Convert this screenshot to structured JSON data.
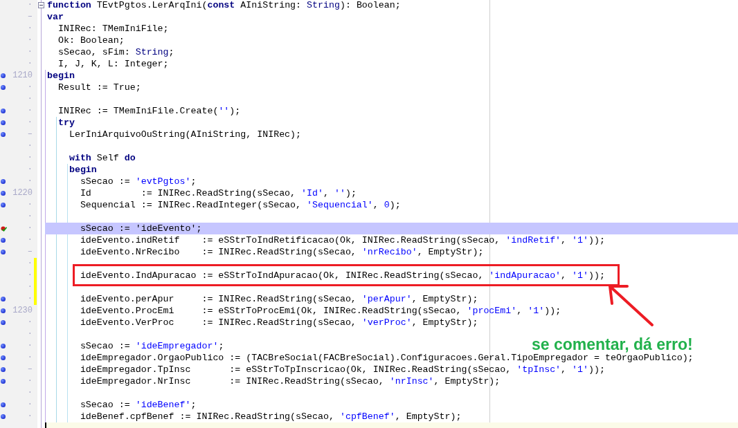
{
  "editor": {
    "lines": [
      {
        "gutter": "·",
        "breakpoint": false,
        "modified": false,
        "expanded": true,
        "highlighted": false,
        "tokens": [
          {
            "kind": "keyword",
            "text": "function"
          },
          {
            "kind": "plain",
            "text": " TEvtPgtos.LerArqIni("
          },
          {
            "kind": "keyword",
            "text": "const"
          },
          {
            "kind": "plain",
            "text": " AIniString: "
          },
          {
            "kind": "type",
            "text": "String"
          },
          {
            "kind": "plain",
            "text": "): Boolean;"
          }
        ]
      },
      {
        "gutter": "–",
        "breakpoint": false,
        "modified": false,
        "highlighted": false,
        "tokens": [
          {
            "kind": "keyword",
            "text": "var"
          }
        ]
      },
      {
        "gutter": "·",
        "breakpoint": false,
        "modified": false,
        "highlighted": false,
        "tokens": [
          {
            "kind": "plain",
            "text": "  INIRec: TMemIniFile;"
          }
        ]
      },
      {
        "gutter": "·",
        "breakpoint": false,
        "modified": false,
        "highlighted": false,
        "tokens": [
          {
            "kind": "plain",
            "text": "  Ok: Boolean;"
          }
        ]
      },
      {
        "gutter": "·",
        "breakpoint": false,
        "modified": false,
        "highlighted": false,
        "tokens": [
          {
            "kind": "plain",
            "text": "  sSecao, sFim: "
          },
          {
            "kind": "type",
            "text": "String"
          },
          {
            "kind": "plain",
            "text": ";"
          }
        ]
      },
      {
        "gutter": "·",
        "breakpoint": false,
        "modified": false,
        "highlighted": false,
        "tokens": [
          {
            "kind": "plain",
            "text": "  I, J, K, L: Integer;"
          }
        ]
      },
      {
        "gutter": "1210",
        "breakpoint": true,
        "modified": false,
        "highlighted": false,
        "tokens": [
          {
            "kind": "keyword",
            "text": "begin"
          }
        ]
      },
      {
        "gutter": "·",
        "breakpoint": true,
        "modified": false,
        "highlighted": false,
        "tokens": [
          {
            "kind": "plain",
            "text": "  Result := True;"
          }
        ]
      },
      {
        "gutter": "·",
        "breakpoint": false,
        "modified": false,
        "highlighted": false
      },
      {
        "gutter": "·",
        "breakpoint": true,
        "modified": false,
        "highlighted": false,
        "tokens": [
          {
            "kind": "plain",
            "text": "  INIRec := TMemIniFile.Create("
          },
          {
            "kind": "string",
            "text": "''"
          },
          {
            "kind": "plain",
            "text": ");"
          }
        ]
      },
      {
        "gutter": "·",
        "breakpoint": true,
        "modified": false,
        "highlighted": false,
        "tokens": [
          {
            "kind": "keyword",
            "text": "  try"
          }
        ]
      },
      {
        "gutter": "–",
        "breakpoint": true,
        "modified": false,
        "highlighted": false,
        "tokens": [
          {
            "kind": "plain",
            "text": "    LerIniArquivoOuString(AIniString, INIRec);"
          }
        ]
      },
      {
        "gutter": "·",
        "breakpoint": false,
        "modified": false,
        "highlighted": false
      },
      {
        "gutter": "·",
        "breakpoint": false,
        "modified": false,
        "highlighted": false,
        "tokens": [
          {
            "kind": "keyword",
            "text": "    with"
          },
          {
            "kind": "plain",
            "text": " Self "
          },
          {
            "kind": "keyword",
            "text": "do"
          }
        ]
      },
      {
        "gutter": "·",
        "breakpoint": false,
        "modified": false,
        "highlighted": false,
        "tokens": [
          {
            "kind": "keyword",
            "text": "    begin"
          }
        ]
      },
      {
        "gutter": "·",
        "breakpoint": true,
        "modified": false,
        "highlighted": false,
        "tokens": [
          {
            "kind": "plain",
            "text": "      sSecao := "
          },
          {
            "kind": "string",
            "text": "'evtPgtos'"
          },
          {
            "kind": "plain",
            "text": ";"
          }
        ]
      },
      {
        "gutter": "1220",
        "breakpoint": true,
        "modified": false,
        "highlighted": false,
        "tokens": [
          {
            "kind": "plain",
            "text": "      Id         := INIRec.ReadString(sSecao, "
          },
          {
            "kind": "string",
            "text": "'Id'"
          },
          {
            "kind": "plain",
            "text": ", "
          },
          {
            "kind": "string",
            "text": "''"
          },
          {
            "kind": "plain",
            "text": ");"
          }
        ]
      },
      {
        "gutter": "·",
        "breakpoint": true,
        "modified": false,
        "highlighted": false,
        "tokens": [
          {
            "kind": "plain",
            "text": "      Sequencial := INIRec.ReadInteger(sSecao, "
          },
          {
            "kind": "string",
            "text": "'Sequencial'"
          },
          {
            "kind": "plain",
            "text": ", "
          },
          {
            "kind": "number",
            "text": "0"
          },
          {
            "kind": "plain",
            "text": ");"
          }
        ]
      },
      {
        "gutter": "·",
        "breakpoint": false,
        "modified": false,
        "highlighted": false
      },
      {
        "gutter": "·",
        "breakpoint": true,
        "verified": true,
        "modified": false,
        "highlighted": true,
        "tokens": [
          {
            "kind": "plain",
            "text": "      sSecao := 'ideEvento';"
          }
        ]
      },
      {
        "gutter": "·",
        "breakpoint": true,
        "modified": false,
        "highlighted": false,
        "tokens": [
          {
            "kind": "plain",
            "text": "      ideEvento.indRetif    := eSStrToIndRetificacao(Ok, INIRec.ReadString(sSecao, "
          },
          {
            "kind": "string",
            "text": "'indRetif'"
          },
          {
            "kind": "plain",
            "text": ", "
          },
          {
            "kind": "string",
            "text": "'1'"
          },
          {
            "kind": "plain",
            "text": "));"
          }
        ]
      },
      {
        "gutter": "–",
        "breakpoint": true,
        "modified": false,
        "highlighted": false,
        "tokens": [
          {
            "kind": "plain",
            "text": "      ideEvento.NrRecibo    := INIRec.ReadString(sSecao, "
          },
          {
            "kind": "string",
            "text": "'nrRecibo'"
          },
          {
            "kind": "plain",
            "text": ", EmptyStr);"
          }
        ]
      },
      {
        "gutter": "·",
        "breakpoint": false,
        "modified": true,
        "highlighted": false
      },
      {
        "gutter": "·",
        "breakpoint": false,
        "modified": true,
        "highlighted": false,
        "tokens": [
          {
            "kind": "plain",
            "text": "      ideEvento.IndApuracao := eSStrToIndApuracao(Ok, INIRec.ReadString(sSecao, "
          },
          {
            "kind": "string",
            "text": "'indApuracao'"
          },
          {
            "kind": "plain",
            "text": ", "
          },
          {
            "kind": "string",
            "text": "'1'"
          },
          {
            "kind": "plain",
            "text": "));"
          }
        ]
      },
      {
        "gutter": "·",
        "breakpoint": false,
        "modified": true,
        "highlighted": false
      },
      {
        "gutter": "·",
        "breakpoint": true,
        "modified": true,
        "highlighted": false,
        "tokens": [
          {
            "kind": "plain",
            "text": "      ideEvento.perApur     := INIRec.ReadString(sSecao, "
          },
          {
            "kind": "string",
            "text": "'perApur'"
          },
          {
            "kind": "plain",
            "text": ", EmptyStr);"
          }
        ]
      },
      {
        "gutter": "1230",
        "breakpoint": true,
        "modified": false,
        "highlighted": false,
        "tokens": [
          {
            "kind": "plain",
            "text": "      ideEvento.ProcEmi     := eSStrToProcEmi(Ok, INIRec.ReadString(sSecao, "
          },
          {
            "kind": "string",
            "text": "'procEmi'"
          },
          {
            "kind": "plain",
            "text": ", "
          },
          {
            "kind": "string",
            "text": "'1'"
          },
          {
            "kind": "plain",
            "text": "));"
          }
        ]
      },
      {
        "gutter": "·",
        "breakpoint": true,
        "modified": false,
        "highlighted": false,
        "tokens": [
          {
            "kind": "plain",
            "text": "      ideEvento.VerProc     := INIRec.ReadString(sSecao, "
          },
          {
            "kind": "string",
            "text": "'verProc'"
          },
          {
            "kind": "plain",
            "text": ", EmptyStr);"
          }
        ]
      },
      {
        "gutter": "·",
        "breakpoint": false,
        "modified": false,
        "highlighted": false
      },
      {
        "gutter": "·",
        "breakpoint": true,
        "modified": false,
        "highlighted": false,
        "tokens": [
          {
            "kind": "plain",
            "text": "      sSecao := "
          },
          {
            "kind": "string",
            "text": "'ideEmpregador'"
          },
          {
            "kind": "plain",
            "text": ";"
          }
        ]
      },
      {
        "gutter": "·",
        "breakpoint": true,
        "modified": false,
        "highlighted": false,
        "tokens": [
          {
            "kind": "plain",
            "text": "      ideEmpregador.OrgaoPublico := (TACBreSocial(FACBreSocial).Configuracoes.Geral.TipoEmpregador = teOrgaoPublico);"
          }
        ]
      },
      {
        "gutter": "–",
        "breakpoint": true,
        "modified": false,
        "highlighted": false,
        "tokens": [
          {
            "kind": "plain",
            "text": "      ideEmpregador.TpInsc       := eSStrToTpInscricao(Ok, INIRec.ReadString(sSecao, "
          },
          {
            "kind": "string",
            "text": "'tpInsc'"
          },
          {
            "kind": "plain",
            "text": ", "
          },
          {
            "kind": "string",
            "text": "'1'"
          },
          {
            "kind": "plain",
            "text": "));"
          }
        ]
      },
      {
        "gutter": "·",
        "breakpoint": true,
        "modified": false,
        "highlighted": false,
        "tokens": [
          {
            "kind": "plain",
            "text": "      ideEmpregador.NrInsc       := INIRec.ReadString(sSecao, "
          },
          {
            "kind": "string",
            "text": "'nrInsc'"
          },
          {
            "kind": "plain",
            "text": ", EmptyStr);"
          }
        ]
      },
      {
        "gutter": "·",
        "breakpoint": false,
        "modified": false,
        "highlighted": false
      },
      {
        "gutter": "·",
        "breakpoint": true,
        "modified": false,
        "highlighted": false,
        "tokens": [
          {
            "kind": "plain",
            "text": "      sSecao := "
          },
          {
            "kind": "string",
            "text": "'ideBenef'"
          },
          {
            "kind": "plain",
            "text": ";"
          }
        ]
      },
      {
        "gutter": "·",
        "breakpoint": true,
        "modified": false,
        "highlighted": false,
        "tokens": [
          {
            "kind": "plain",
            "text": "      ideBenef.cpfBenef := INIRec.ReadString(sSecao, "
          },
          {
            "kind": "string",
            "text": "'cpfBenef'"
          },
          {
            "kind": "plain",
            "text": ", EmptyStr);"
          }
        ]
      },
      {
        "breakpoint": false,
        "modified": false,
        "highlighted": false,
        "current": true
      }
    ]
  },
  "annotation": {
    "note": "se comentar, dá erro!"
  }
}
